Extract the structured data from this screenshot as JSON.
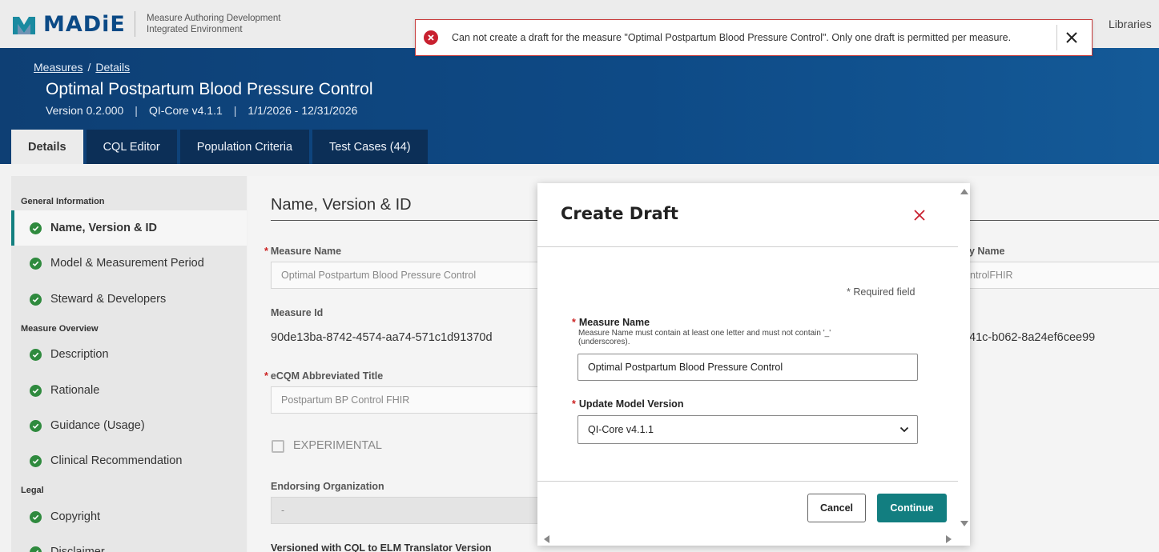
{
  "app": {
    "logo_text": "MADiE",
    "subtitle_line1": "Measure Authoring Development",
    "subtitle_line2": "Integrated Environment",
    "nav_libraries": "Libraries"
  },
  "toast": {
    "message": "Can not create a draft for the measure \"Optimal Postpartum Blood Pressure Control\". Only one draft is permitted per measure."
  },
  "breadcrumb": {
    "measures": "Measures",
    "separator": "/",
    "details": "Details"
  },
  "measure": {
    "title": "Optimal Postpartum Blood Pressure Control",
    "version": "Version 0.2.000",
    "model": "QI-Core v4.1.1",
    "period": "1/1/2026 - 12/31/2026",
    "meta_separator": "|"
  },
  "tabs": [
    {
      "label": "Details"
    },
    {
      "label": "CQL Editor"
    },
    {
      "label": "Population Criteria"
    },
    {
      "label": "Test Cases (44)"
    }
  ],
  "leftnav": {
    "general_heading": "General Information",
    "overview_heading": "Measure Overview",
    "legal_heading": "Legal",
    "items": [
      {
        "label": "Name, Version & ID"
      },
      {
        "label": "Model & Measurement Period"
      },
      {
        "label": "Steward & Developers"
      },
      {
        "label": "Description"
      },
      {
        "label": "Rationale"
      },
      {
        "label": "Guidance (Usage)"
      },
      {
        "label": "Clinical Recommendation"
      },
      {
        "label": "Copyright"
      },
      {
        "label": "Disclaimer"
      }
    ]
  },
  "main": {
    "section_title": "Name, Version & ID",
    "measure_name_label": "Measure Name",
    "measure_name_value": "Optimal Postpartum Blood Pressure Control",
    "library_name_label_partial": "y Name",
    "library_name_value_partial": "ntrolFHIR",
    "measure_id_label": "Measure Id",
    "measure_id_value": "90de13ba-8742-4574-aa74-571c1d91370d",
    "other_id_partial": "41c-b062-8a24ef6cee99",
    "ecqm_label": "eCQM Abbreviated Title",
    "ecqm_value": "Postpartum BP Control FHIR",
    "experimental_label": "EXPERIMENTAL",
    "endorsing_label": "Endorsing Organization",
    "endorsing_value": "-",
    "versioned_label": "Versioned with CQL to ELM Translator Version"
  },
  "modal": {
    "title": "Create Draft",
    "required_note": "* Required field",
    "measure_name_label": "Measure Name",
    "measure_name_help": "Measure Name must contain at least one letter and must not contain '_' (underscores).",
    "measure_name_value": "Optimal Postpartum Blood Pressure Control",
    "model_label": "Update Model Version",
    "model_value": "QI-Core v4.1.1",
    "cancel_label": "Cancel",
    "continue_label": "Continue"
  },
  "colors": {
    "brand_blue": "#0b4a86",
    "accent_teal": "#127e80",
    "error_red": "#c8202f",
    "check_green": "#2f8a3e"
  }
}
